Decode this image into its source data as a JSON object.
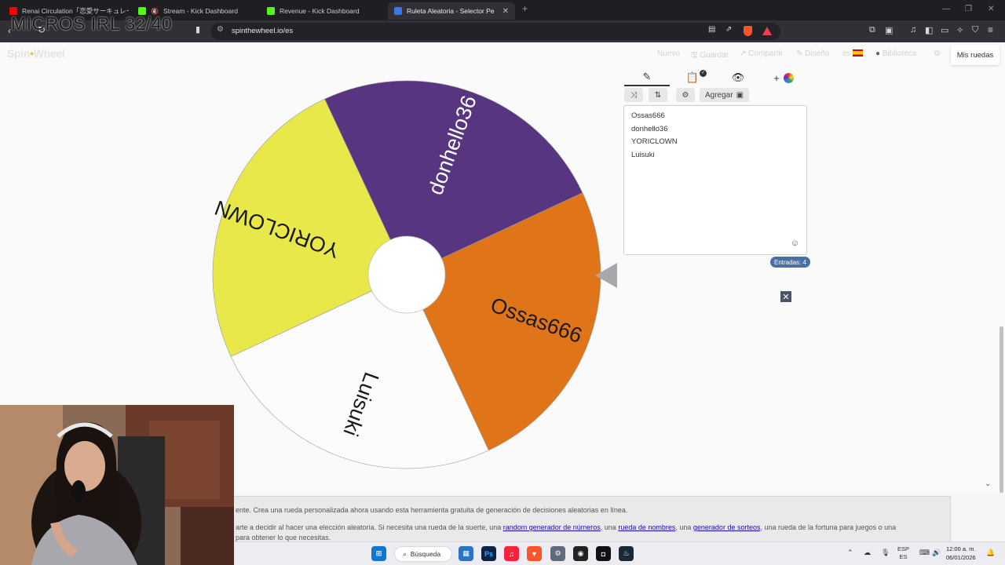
{
  "overlay": {
    "text": "MICROS IRL 32/40"
  },
  "browser": {
    "tabs": [
      {
        "label": "Renai Circulation「恋愛サーキュレーション」",
        "favicon_color": "#ff0000"
      },
      {
        "label": "Stream - Kick Dashboard",
        "favicon_color": "#53fc18"
      },
      {
        "label": "Revenue - Kick Dashboard",
        "favicon_color": "#53fc18"
      },
      {
        "label": "Ruleta Aleatoria - Selector Personalizado",
        "favicon_color": "#3b78e7"
      }
    ],
    "url": "spinthewheel.io/es"
  },
  "site": {
    "logo_left": "Spin",
    "logo_right": "Wheel",
    "nav": {
      "nuevo": "Nuevo",
      "guardar": "Guardar",
      "compartir": "Compartir",
      "diseno": "Diseño",
      "lang": "es",
      "biblioteca": "Biblioteca",
      "mis_ruedas": "Mis ruedas"
    }
  },
  "wheel": {
    "segments": [
      {
        "label": "Ossas666",
        "color": "#e07419",
        "text_color": "#1a1a1a"
      },
      {
        "label": "Luisuki",
        "color": "#fcfcfc",
        "text_color": "#1a1a1a"
      },
      {
        "label": "YORICLOWN",
        "color": "#e8e84a",
        "text_color": "#1a1a1a"
      },
      {
        "label": "donhello36",
        "color": "#573580",
        "text_color": "#ffffff"
      }
    ]
  },
  "panel": {
    "add_button": "Agregar",
    "entries": [
      "Ossas666",
      "donhello36",
      "YORICLOWN",
      "Luisuki"
    ],
    "count_label": "Entradas: 4"
  },
  "info": {
    "line1": "ente. Crea una rueda personalizada ahora usando esta herramienta gratuita de generación de decisiones aleatorias en línea.",
    "line2_a": "arte a decidir al hacer una elección aleatoria. Si necesita una rueda de la suerte, una ",
    "link1": "random generador de números",
    "line2_b": ", una ",
    "link2": "rueda de nombres",
    "line2_c": ", una ",
    "link3": "generador de sorteos",
    "line2_d": ", una rueda de la fortuna para juegos o una",
    "line3": "para obtener lo que necesitas."
  },
  "taskbar": {
    "search": "Búsqueda",
    "lang_top": "ESP",
    "lang_bottom": "ES",
    "time": "12:00 a. m.",
    "date": "06/01/2026"
  }
}
